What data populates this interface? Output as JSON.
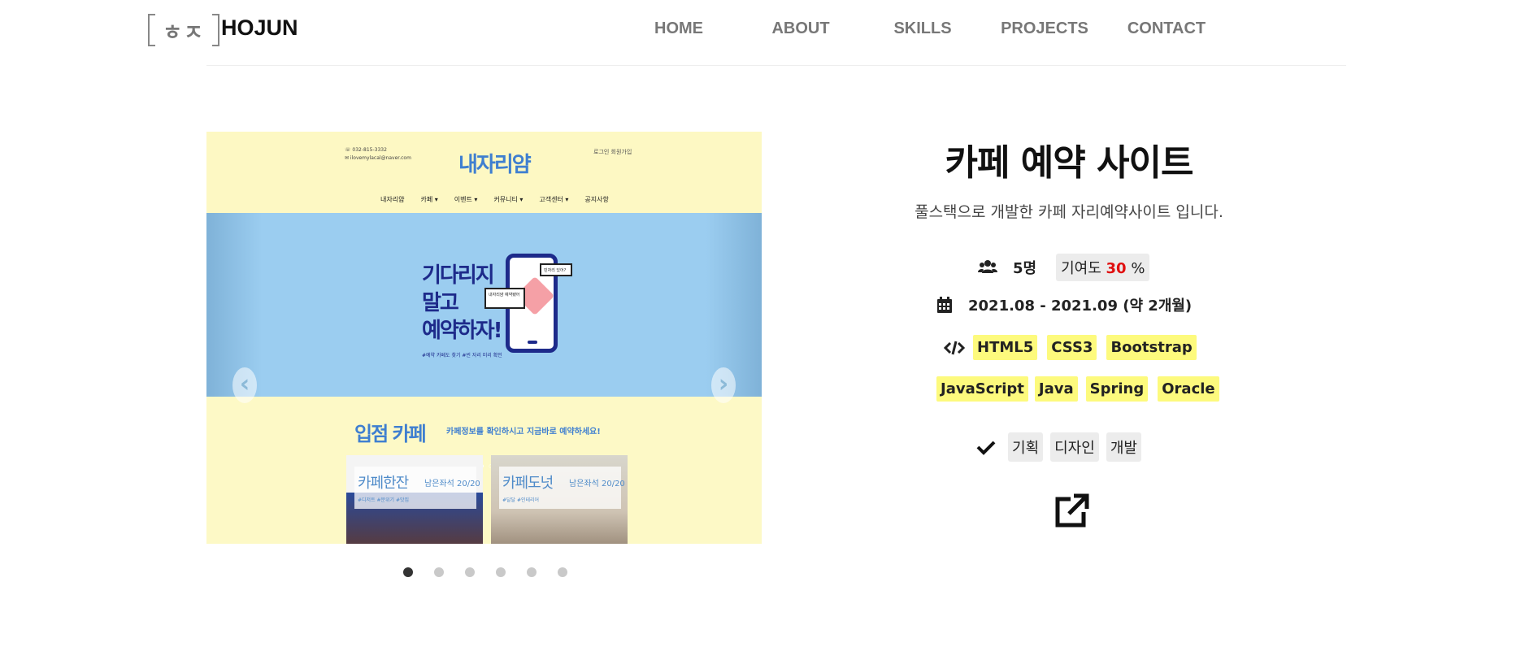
{
  "header": {
    "logo_glyph": "ㅎㅈ",
    "logo_text": "HOJUN",
    "nav": [
      "HOME",
      "ABOUT",
      "SKILLS",
      "PROJECTS",
      "CONTACT"
    ]
  },
  "carousel": {
    "prev_icon": "‹",
    "next_icon": "›",
    "slide": {
      "contact": "☏ 032-815-3332\n✉ ilovemylacal@naver.com",
      "logo": "내자리얌",
      "links": "로그인   회원가입",
      "menu": [
        "내자리얌",
        "카페 ▾",
        "이벤트 ▾",
        "커뮤니티 ▾",
        "고객센터 ▾",
        "공지사항"
      ],
      "banner_text": "기다리지\n말고\n예약하자!",
      "banner_sub": "#예약 카페도 찾기 #빈 자리 미리 확인",
      "bubble1": "빈자리 있어?",
      "bubble2": "내자리얌 예약됐어",
      "section_title": "입점 카페",
      "section_sub": "카페정보를 확인하시고 지금바로 예약하세요!",
      "cards": [
        {
          "name": "카페한잔",
          "seats": "남은좌석 20/20",
          "tags": "#디저트 #분위기 #맛집"
        },
        {
          "name": "카페도넛",
          "seats": "남은좌석 20/20",
          "tags": "#달달 #인테리어"
        }
      ]
    },
    "dots_count": 6,
    "active_dot": 0
  },
  "project": {
    "title": "카페 예약 사이트",
    "description": "풀스택으로 개발한 카페 자리예약사이트 입니다.",
    "team_size": "5명",
    "contribution_label": "기여도",
    "contribution_value": "30",
    "contribution_unit": "%",
    "period": "2021.08 - 2021.09 (약 2개월)",
    "tech_row1": [
      "HTML5",
      "CSS3",
      "Bootstrap"
    ],
    "tech_row2": [
      "JavaScript",
      "Java",
      "Spring",
      "Oracle"
    ],
    "roles": [
      "기획",
      "디자인",
      "개발"
    ]
  },
  "icons": {
    "team": "users-icon",
    "period": "calendar-icon",
    "tech": "code-icon",
    "role": "check-icon",
    "external": "external-link-icon"
  },
  "colors": {
    "tag_bg": "#fdfa7d",
    "chip_bg": "#ececec",
    "accent_red": "#e01010",
    "nav_text": "#777777"
  }
}
